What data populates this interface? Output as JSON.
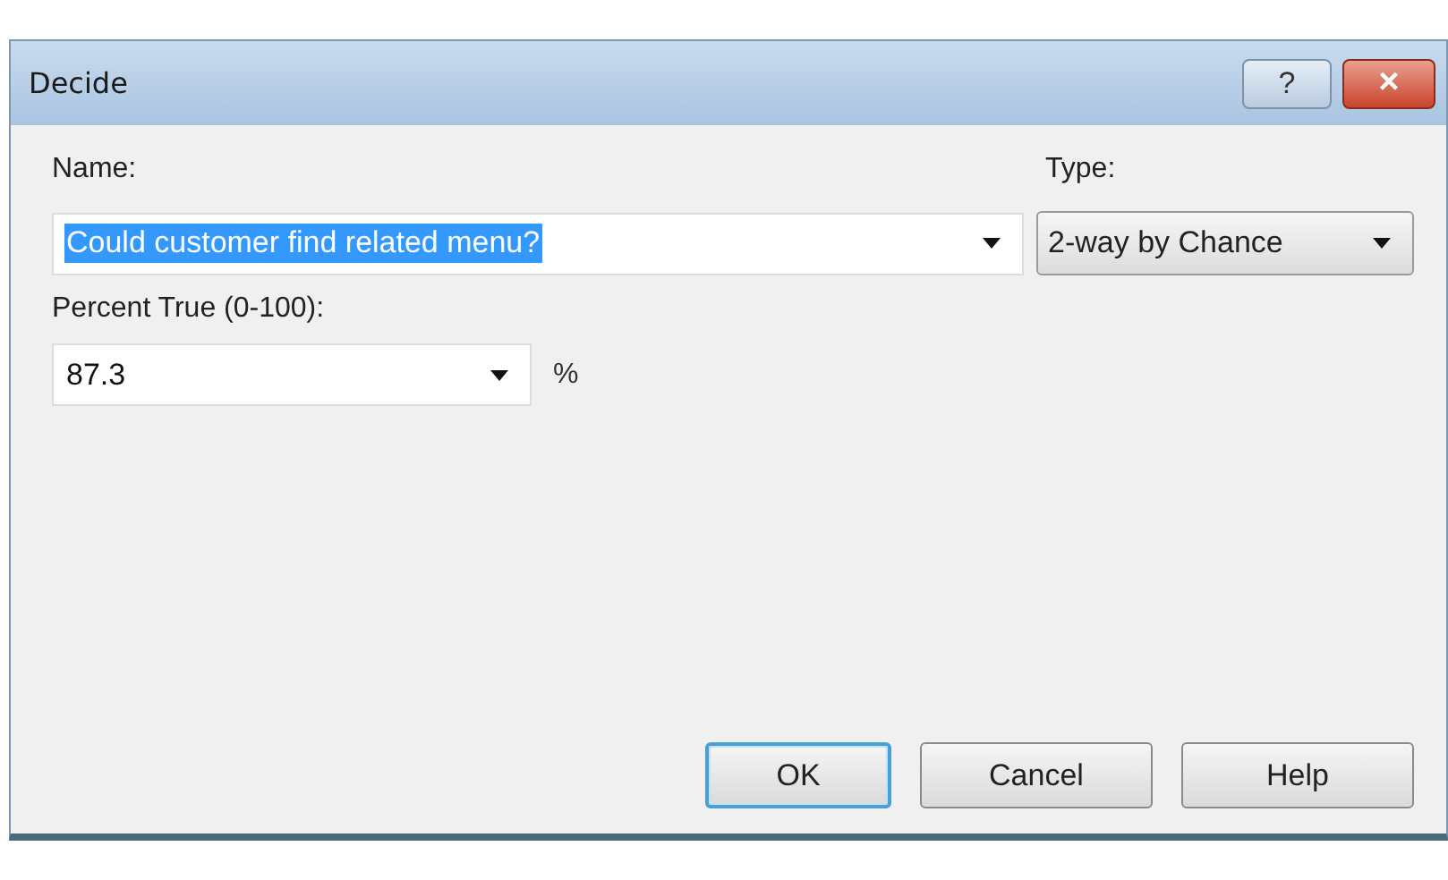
{
  "window": {
    "title": "Decide",
    "title_buttons": [
      {
        "kind": "help",
        "label": "?"
      },
      {
        "kind": "close",
        "label": "×"
      }
    ]
  },
  "name": {
    "label": "Name:",
    "value": "Could customer find related menu?",
    "text_selected": true
  },
  "type": {
    "label": "Type:",
    "value": "2-way by Chance"
  },
  "percent": {
    "label": "Percent True (0-100):",
    "value": "87.3",
    "unit": "%"
  },
  "buttons": [
    {
      "label": "OK",
      "default": true
    },
    {
      "label": "Cancel",
      "default": false
    },
    {
      "label": "Help",
      "default": false
    }
  ]
}
